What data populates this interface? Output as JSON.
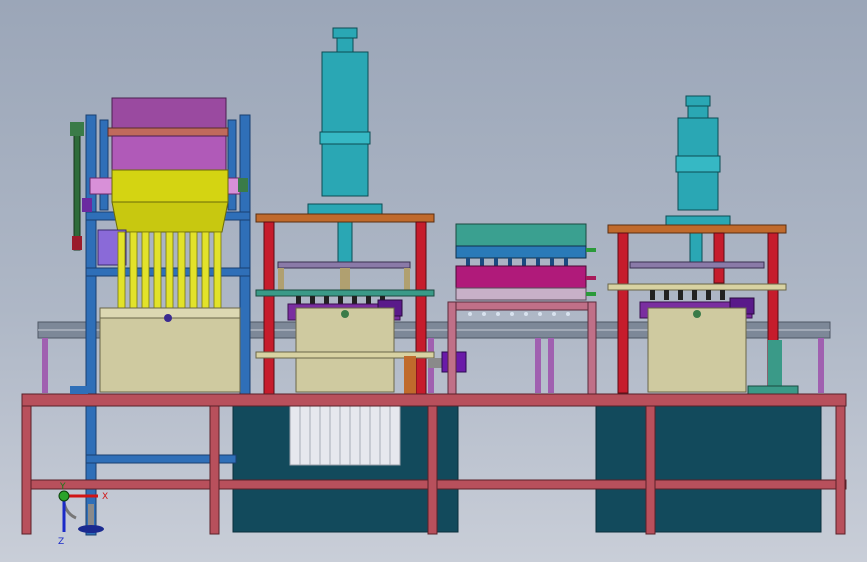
{
  "colors": {
    "frame_red": "#b8505c",
    "pillar_red": "#c61c2c",
    "blue_frame": "#2f6fb8",
    "teal_cylinder": "#2aa7b4",
    "yellow_hopper": "#d4d412",
    "purple": "#7a2ea0",
    "magenta": "#b01a7a",
    "beige_box": "#cfcaa0",
    "tank_dark": "#124a5c",
    "orange_plate": "#c06a2c",
    "green_plate": "#3a9a88",
    "conveyor_grey": "#7d8898"
  },
  "triad": {
    "x_label": "X",
    "y_label": "Y",
    "z_label": "Z"
  }
}
